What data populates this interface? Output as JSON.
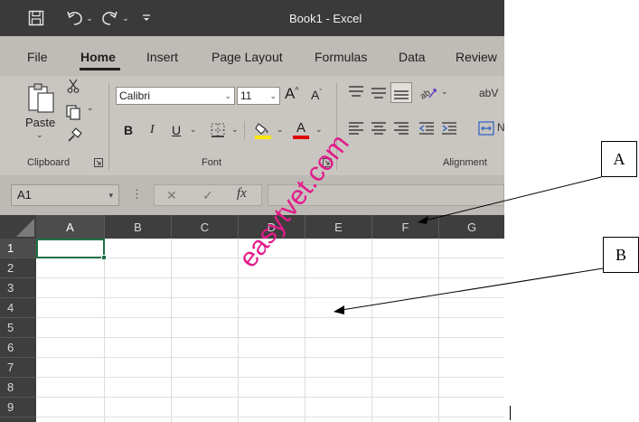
{
  "window": {
    "title": "Book1  -  Excel"
  },
  "tabs": [
    {
      "label": "File"
    },
    {
      "label": "Home"
    },
    {
      "label": "Insert"
    },
    {
      "label": "Page Layout"
    },
    {
      "label": "Formulas"
    },
    {
      "label": "Data"
    },
    {
      "label": "Review"
    }
  ],
  "ribbon": {
    "clipboard": {
      "paste_label": "Paste",
      "group_label": "Clipboard"
    },
    "font": {
      "font_name": "Calibri",
      "font_size": "11",
      "bold": "B",
      "italic": "I",
      "underline": "U",
      "grow_font": "A",
      "shrink_font": "A",
      "font_color_glyph": "A",
      "group_label": "Font"
    },
    "alignment": {
      "wrap_text_glyph": "ab",
      "wrap_text_partial": "V",
      "merge_partial": "N",
      "group_label": "Alignment"
    }
  },
  "formula_bar": {
    "name_box": "A1",
    "cancel_glyph": "✕",
    "enter_glyph": "✓",
    "function_glyph": "fx",
    "formula_value": ""
  },
  "grid": {
    "columns": [
      "A",
      "B",
      "C",
      "D",
      "E",
      "F",
      "G"
    ],
    "rows": [
      "1",
      "2",
      "3",
      "4",
      "5",
      "6",
      "7",
      "8",
      "9"
    ],
    "active_cell": "A1"
  },
  "watermark": "easytvet.com",
  "callouts": {
    "a": "A",
    "b": "B"
  },
  "colors": {
    "title_bar": "#3a3a3a",
    "ribbon": "#c9c5c0",
    "active_cell_border": "#1e7145",
    "font_color_underline": "#e00000",
    "highlight_underline": "#ffe600",
    "watermark": "#e21b8a"
  }
}
